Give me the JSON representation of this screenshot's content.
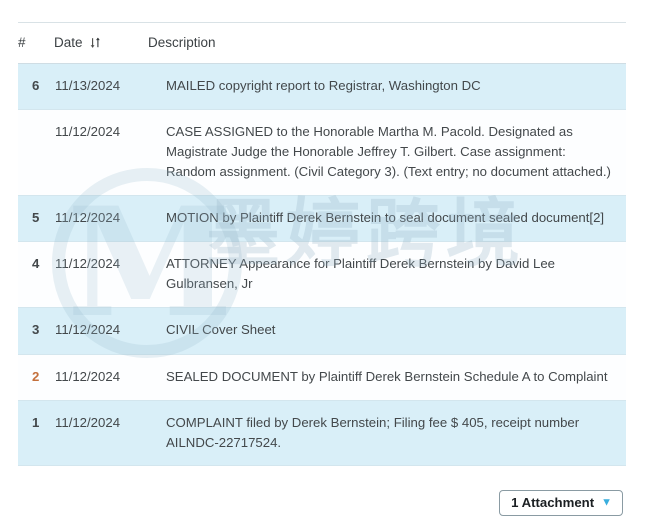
{
  "table": {
    "columns": [
      {
        "key": "num",
        "label": "#"
      },
      {
        "key": "date",
        "label": "Date",
        "sort_icon": "sort-ascending-descending-icon"
      },
      {
        "key": "desc",
        "label": "Description"
      }
    ],
    "rows": [
      {
        "num": "6",
        "num_color": "#2a90c4",
        "date": "11/13/2024",
        "desc": "MAILED copyright report to Registrar, Washington DC",
        "shaded": true
      },
      {
        "num": "",
        "num_color": "",
        "date": "11/12/2024",
        "desc": "CASE ASSIGNED to the Honorable Martha M. Pacold. Designated as Magistrate Judge the Honorable Jeffrey T. Gilbert. Case assignment: Random assignment. (Civil Category 3). (Text entry; no document attached.)",
        "shaded": false
      },
      {
        "num": "5",
        "num_color": "#2a90c4",
        "date": "11/12/2024",
        "desc": "MOTION by Plaintiff Derek Bernstein to seal document sealed document[2]",
        "shaded": true
      },
      {
        "num": "4",
        "num_color": "#2a90c4",
        "date": "11/12/2024",
        "desc": "ATTORNEY Appearance for Plaintiff Derek Bernstein by David Lee Gulbransen, Jr",
        "shaded": false
      },
      {
        "num": "3",
        "num_color": "#2a90c4",
        "date": "11/12/2024",
        "desc": "CIVIL Cover Sheet",
        "shaded": true
      },
      {
        "num": "2",
        "num_color": "#c4703c",
        "date": "11/12/2024",
        "desc": "SEALED DOCUMENT by Plaintiff Derek Bernstein Schedule A to Complaint",
        "shaded": false
      },
      {
        "num": "1",
        "num_color": "#2a90c4",
        "date": "11/12/2024",
        "desc": "COMPLAINT filed by Derek Bernstein; Filing fee $ 405, receipt number AILNDC-22717524.",
        "shaded": true
      }
    ]
  },
  "attachment_button": {
    "label": "1 Attachment",
    "caret": "▼"
  },
  "watermark": {
    "logo_letter": "M",
    "text": "墨婷跨境"
  },
  "colors": {
    "row_shaded": "#d9eff8",
    "row_plain": "#fdfeff",
    "row_border": "#d3e6ee",
    "num_link": "#2a90c4",
    "num_warn": "#c4703c",
    "caret": "#3aaedd"
  }
}
